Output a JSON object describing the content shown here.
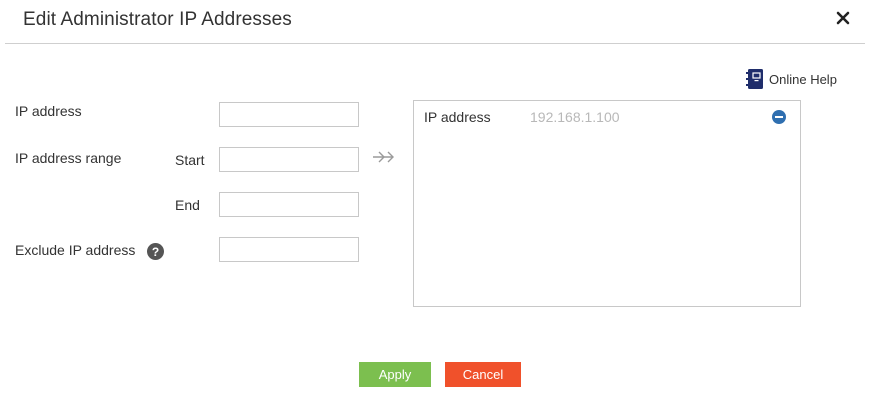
{
  "dialog": {
    "title": "Edit Administrator IP Addresses",
    "close_icon": "close-icon",
    "help_label": "Online Help",
    "help_icon": "address-book-icon"
  },
  "form": {
    "ip_address_label": "IP address",
    "ip_range_label": "IP address range",
    "start_label": "Start",
    "end_label": "End",
    "exclude_label": "Exclude IP address",
    "exclude_help_icon": "question-mark-icon",
    "ip_address_value": "",
    "start_value": "",
    "end_value": "",
    "exclude_value": ""
  },
  "transfer_icon": "double-arrow-right-icon",
  "list": {
    "rows": [
      {
        "label": "IP address",
        "value": "192.168.1.100",
        "remove_icon": "minus-circle-icon"
      }
    ]
  },
  "actions": {
    "apply_label": "Apply",
    "cancel_label": "Cancel"
  },
  "colors": {
    "apply": "#7cbf4f",
    "cancel": "#f0512b",
    "remove": "#2f6fb0",
    "help_icon": "#1f2d6b"
  }
}
